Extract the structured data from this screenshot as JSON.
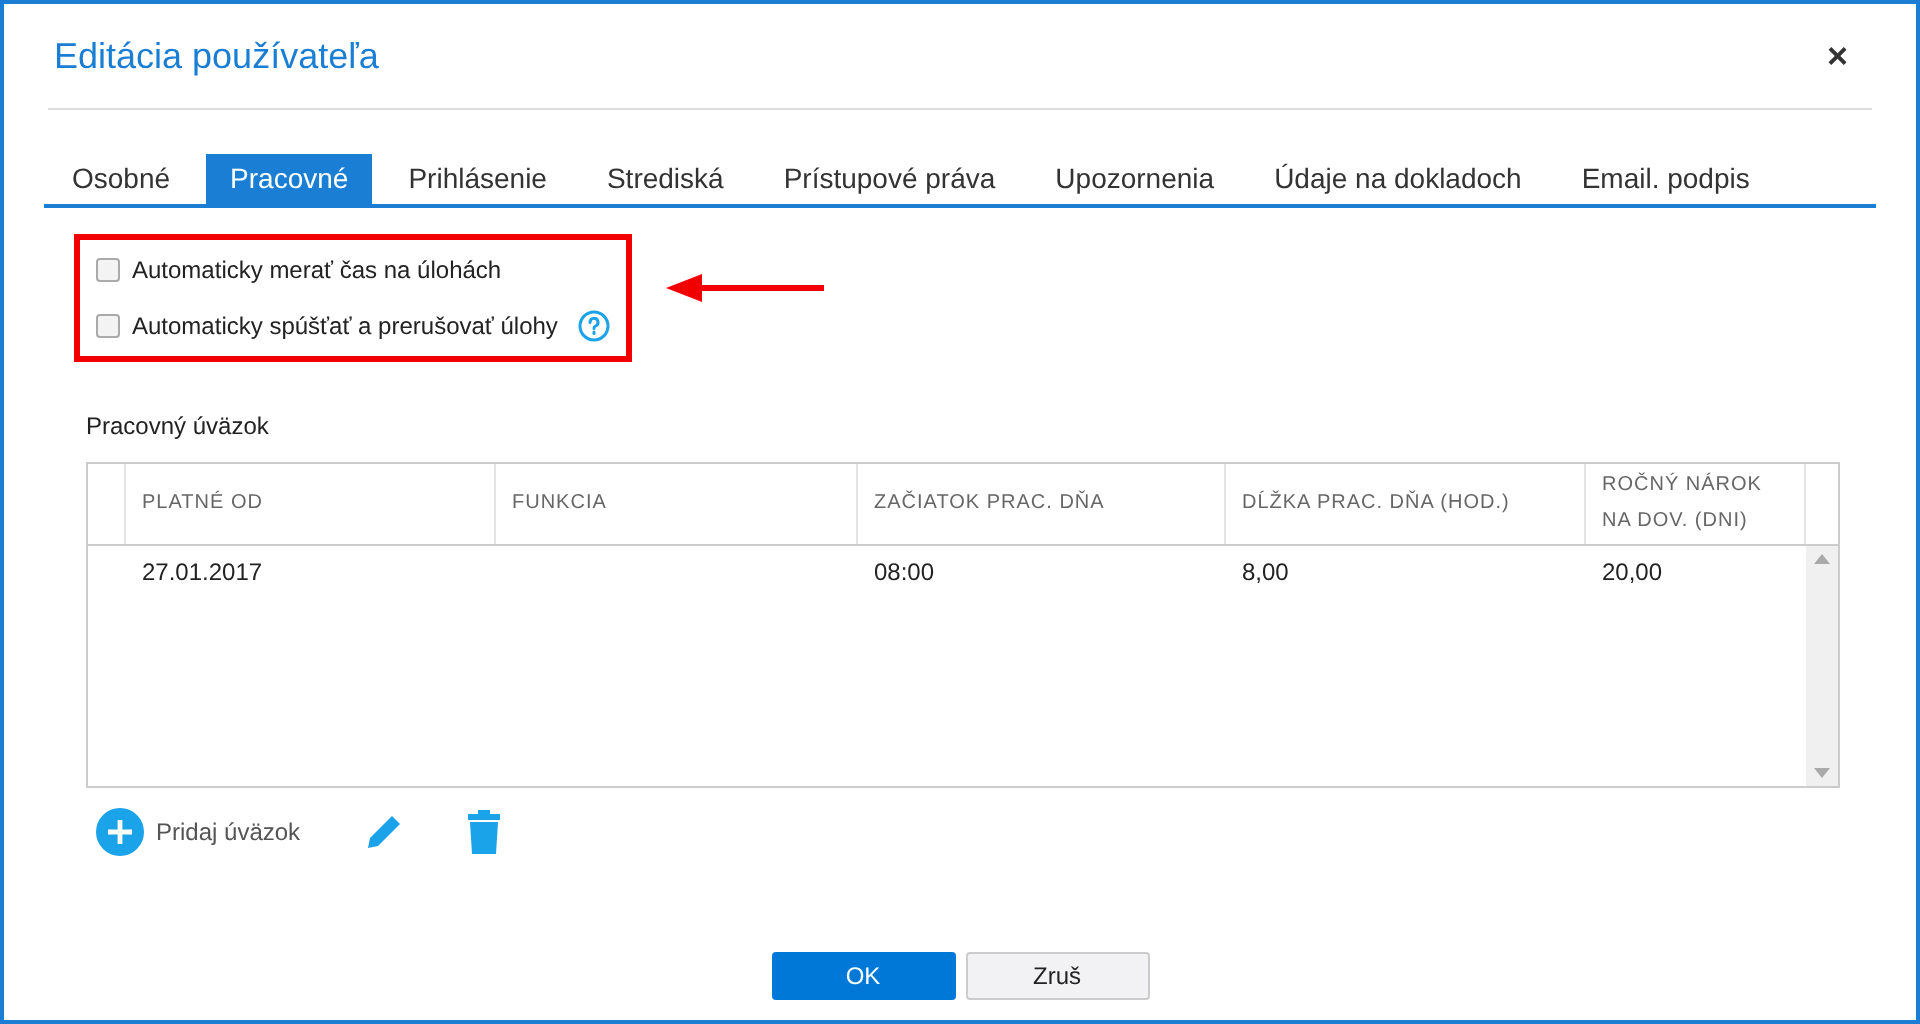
{
  "dialog": {
    "title": "Editácia používateľa",
    "close": "×"
  },
  "tabs": [
    {
      "label": "Osobné",
      "selected": false
    },
    {
      "label": "Pracovné",
      "selected": true
    },
    {
      "label": "Prihlásenie",
      "selected": false
    },
    {
      "label": "Strediská",
      "selected": false
    },
    {
      "label": "Prístupové práva",
      "selected": false
    },
    {
      "label": "Upozornenia",
      "selected": false
    },
    {
      "label": "Údaje na dokladoch",
      "selected": false
    },
    {
      "label": "Email. podpis",
      "selected": false
    }
  ],
  "options": [
    {
      "label": "Automaticky merať čas na úlohách",
      "checked": false,
      "help": false
    },
    {
      "label": "Automaticky spúšťať a prerušovať úlohy",
      "checked": false,
      "help": true
    }
  ],
  "table": {
    "title": "Pracovný úväzok",
    "columns": [
      "PLATNÉ OD",
      "FUNKCIA",
      "ZAČIATOK PRAC. DŇA",
      "DĹŽKA PRAC. DŇA (HOD.)",
      "ROČNÝ NÁROK NA DOV. (DNI)"
    ],
    "rows": [
      [
        "27.01.2017",
        "",
        "08:00",
        "8,00",
        "20,00"
      ]
    ]
  },
  "toolbar": {
    "add": "Pridaj úväzok"
  },
  "buttons": [
    {
      "label": "OK",
      "kind": "primary"
    },
    {
      "label": "Zruš",
      "kind": "secondary"
    }
  ]
}
